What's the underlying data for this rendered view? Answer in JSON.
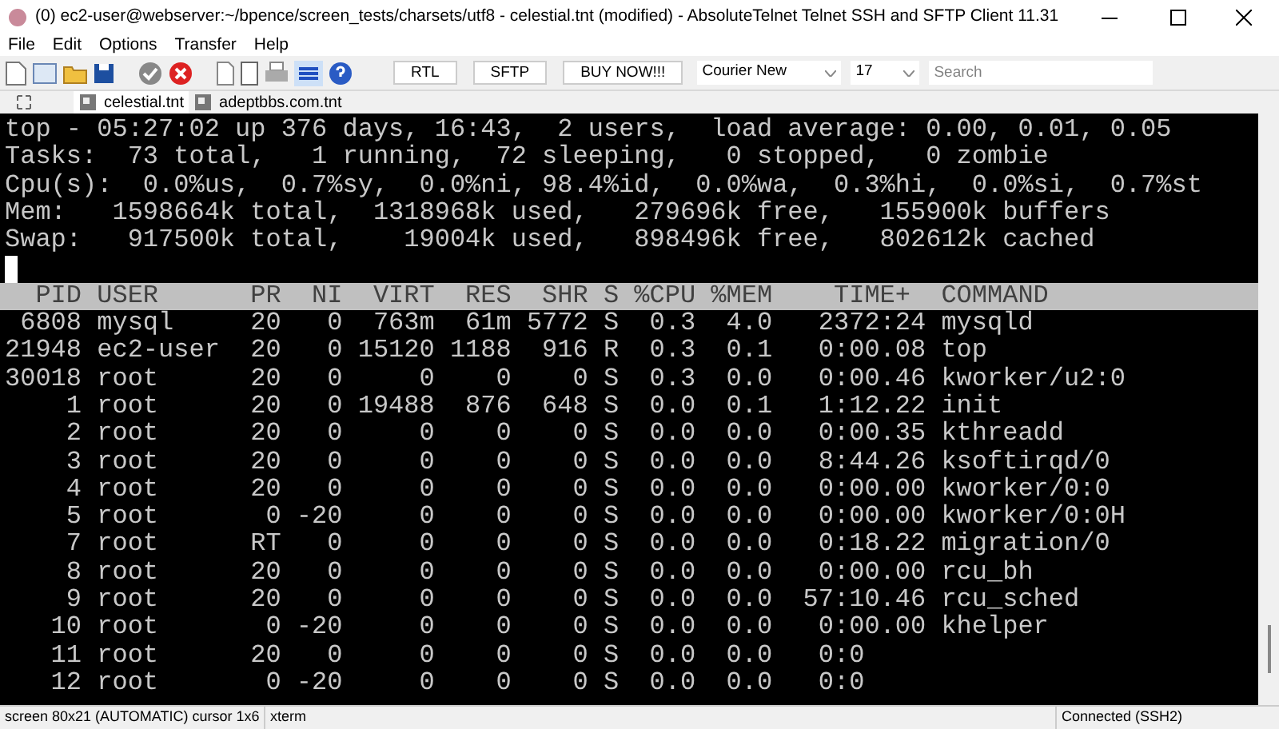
{
  "window": {
    "title": "(0) ec2-user@webserver:~/bpence/screen_tests/charsets/utf8 - celestial.tnt (modified) - AbsoluteTelnet Telnet SSH and SFTP Client 11.31"
  },
  "menu": [
    "File",
    "Edit",
    "Options",
    "Transfer",
    "Help"
  ],
  "toolbar": {
    "icons": [
      {
        "kind": "new"
      },
      {
        "kind": "doc"
      },
      {
        "kind": "folder"
      },
      {
        "kind": "save"
      },
      {
        "kind": "gap"
      },
      {
        "kind": "check"
      },
      {
        "kind": "stop"
      },
      {
        "kind": "gap"
      },
      {
        "kind": "page"
      },
      {
        "kind": "blank"
      },
      {
        "kind": "printer"
      },
      {
        "kind": "lines",
        "selected": true
      },
      {
        "kind": "help"
      }
    ],
    "buttons": [
      "RTL",
      "SFTP",
      "BUY NOW!!!"
    ],
    "font": "Courier New",
    "size": "17",
    "search": {
      "placeholder": "Search"
    }
  },
  "tabs": [
    {
      "label": "celestial.tnt",
      "selected": true
    },
    {
      "label": "adeptbbs.com.tnt",
      "selected": false
    }
  ],
  "terminal": {
    "summary_lines": [
      "top - 05:27:02 up 376 days, 16:43,  2 users,  load average: 0.00, 0.01, 0.05",
      "Tasks:  73 total,   1 running,  72 sleeping,   0 stopped,   0 zombie",
      "Cpu(s):  0.0%us,  0.7%sy,  0.0%ni, 98.4%id,  0.0%wa,  0.3%hi,  0.0%si,  0.7%st",
      "Mem:   1598664k total,  1318968k used,   279696k free,   155900k buffers",
      "Swap:   917500k total,    19004k used,   898496k free,   802612k cached"
    ],
    "header": "  PID USER      PR  NI  VIRT  RES  SHR S %CPU %MEM    TIME+  COMMAND",
    "process_rows": [
      " 6808 mysql     20   0  763m  61m 5772 S  0.3  4.0   2372:24 mysqld",
      "21948 ec2-user  20   0 15120 1188  916 R  0.3  0.1   0:00.08 top",
      "30018 root      20   0     0    0    0 S  0.3  0.0   0:00.46 kworker/u2:0",
      "    1 root      20   0 19488  876  648 S  0.0  0.1   1:12.22 init",
      "    2 root      20   0     0    0    0 S  0.0  0.0   0:00.35 kthreadd",
      "    3 root      20   0     0    0    0 S  0.0  0.0   8:44.26 ksoftirqd/0",
      "    4 root      20   0     0    0    0 S  0.0  0.0   0:00.00 kworker/0:0",
      "    5 root       0 -20     0    0    0 S  0.0  0.0   0:00.00 kworker/0:0H",
      "    7 root      RT   0     0    0    0 S  0.0  0.0   0:18.22 migration/0",
      "    8 root      20   0     0    0    0 S  0.0  0.0   0:00.00 rcu_bh",
      "    9 root      20   0     0    0    0 S  0.0  0.0  57:10.46 rcu_sched",
      "   10 root       0 -20     0    0    0 S  0.0  0.0   0:00.00 khelper",
      "   11 root      20   0     0    0    0 S  0.0  0.0   0:0",
      "   12 root       0 -20     0    0    0 S  0.0  0.0   0:0"
    ]
  },
  "status_bar": [
    "screen 80x21 (AUTOMATIC) cursor 1x6",
    "xterm",
    "Connected (SSH2)"
  ]
}
